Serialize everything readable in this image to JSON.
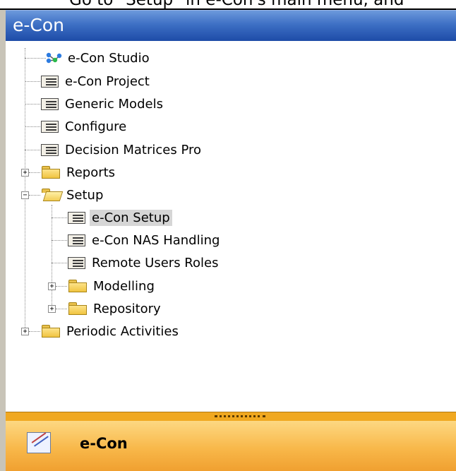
{
  "caption": "Go to \"Setup\" in e-Con's main menu, and",
  "header": {
    "title": "e-Con"
  },
  "tree": {
    "items": [
      {
        "label": "e-Con Studio"
      },
      {
        "label": "e-Con Project"
      },
      {
        "label": "Generic Models"
      },
      {
        "label": "Configure"
      },
      {
        "label": "Decision Matrices Pro"
      },
      {
        "label": "Reports"
      },
      {
        "label": "Setup"
      },
      {
        "label": "e-Con Setup"
      },
      {
        "label": "e-Con NAS Handling"
      },
      {
        "label": "Remote Users Roles"
      },
      {
        "label": "Modelling"
      },
      {
        "label": "Repository"
      },
      {
        "label": "Periodic Activities"
      }
    ],
    "selected": "e-Con Setup"
  },
  "footer": {
    "title": "e-Con"
  },
  "colors": {
    "header": "#2f5fb8",
    "footer": "#f8b84a",
    "splitter": "#f0a820",
    "selection": "#d6d6d6"
  },
  "icons": {
    "studio": "network-nodes-icon",
    "form": "form-list-icon",
    "folder": "folder-icon",
    "folder_open": "folder-open-icon",
    "app": "chart-grid-icon"
  }
}
